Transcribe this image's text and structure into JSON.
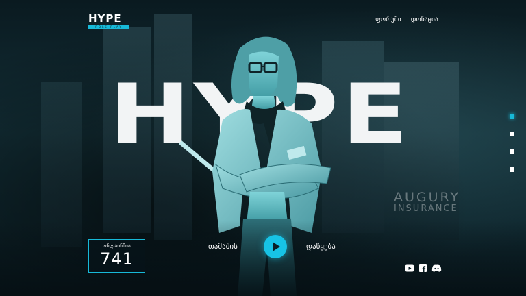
{
  "brand": {
    "logo_text": "HYPE",
    "logo_tagline": "ROLE PLAY",
    "accent_color": "#17b9d8"
  },
  "nav": {
    "items": [
      {
        "label": "ფორუმი"
      },
      {
        "label": "დონაცია"
      }
    ]
  },
  "hero": {
    "big_title": "HYPE",
    "background_sign_line1": "AUGURY",
    "background_sign_line2": "INSURANCE"
  },
  "online": {
    "label": "ონლაინშია",
    "count": "741"
  },
  "actions": {
    "play_label": "თამაშის",
    "play_button_icon": "play-icon",
    "start_label": "დაწყება"
  },
  "slider": {
    "count": 4,
    "active_index": 0
  },
  "social": {
    "icons": [
      "youtube-icon",
      "facebook-icon",
      "discord-icon"
    ]
  }
}
